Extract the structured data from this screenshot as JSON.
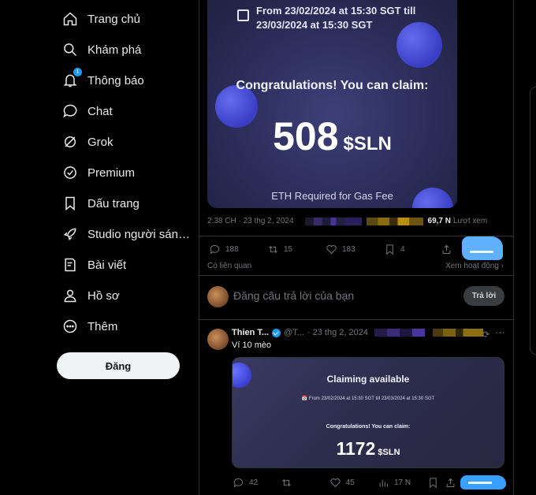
{
  "sidebar": {
    "items": [
      {
        "label": "Trang chủ",
        "icon": "home-icon"
      },
      {
        "label": "Khám phá",
        "icon": "search-icon"
      },
      {
        "label": "Thông báo",
        "icon": "bell-icon",
        "badge": "1"
      },
      {
        "label": "Chat",
        "icon": "chat-icon"
      },
      {
        "label": "Grok",
        "icon": "grok-icon"
      },
      {
        "label": "Premium",
        "icon": "premium-icon"
      },
      {
        "label": "Dấu trang",
        "icon": "bookmark-icon"
      },
      {
        "label": "Studio người sán…",
        "icon": "rocket-icon"
      },
      {
        "label": "Bài viết",
        "icon": "article-icon"
      },
      {
        "label": "Hồ sơ",
        "icon": "profile-icon"
      },
      {
        "label": "Thêm",
        "icon": "more-icon"
      }
    ],
    "post_button": "Đăng"
  },
  "tweet1": {
    "card": {
      "date_line1": "From 23/02/2024 at 15:30 SGT till",
      "date_line2": "23/03/2024 at 15:30 SGT",
      "congrats": "Congratulations! You can claim:",
      "amount": "508",
      "token": "$SLN",
      "fee_note": "ETH Required for Gas Fee"
    },
    "meta": {
      "time": "2:38 CH · 23 thg 2, 2024",
      "views": "69,7 N",
      "views_label": "Lượt xem"
    },
    "actions": {
      "replies": "188",
      "reposts": "15",
      "likes": "183",
      "bookmarks": "4"
    },
    "related_label": "Có liên quan",
    "more_activity": "Xem hoạt động"
  },
  "reply_box": {
    "placeholder": "Đăng câu trả lời của bạn",
    "button": "Trả lời"
  },
  "tweet2": {
    "name": "Thien T...",
    "handle": "@T...",
    "date": "· 23 thg 2, 2024",
    "text": "Ví 10 mèo",
    "card": {
      "title": "Claiming available",
      "date_line": "From 23/02/2024 at 15:30 SGT till 23/03/2024 at 15:30 SGT",
      "congrats": "Congratulations! You can claim:",
      "amount": "1172",
      "token": "$SLN"
    },
    "actions": {
      "replies": "42",
      "likes": "45",
      "views": "17 N"
    }
  },
  "colors": {
    "accent": "#1d9bf0",
    "background": "#000000",
    "card_bg": "#2c2d5a"
  }
}
